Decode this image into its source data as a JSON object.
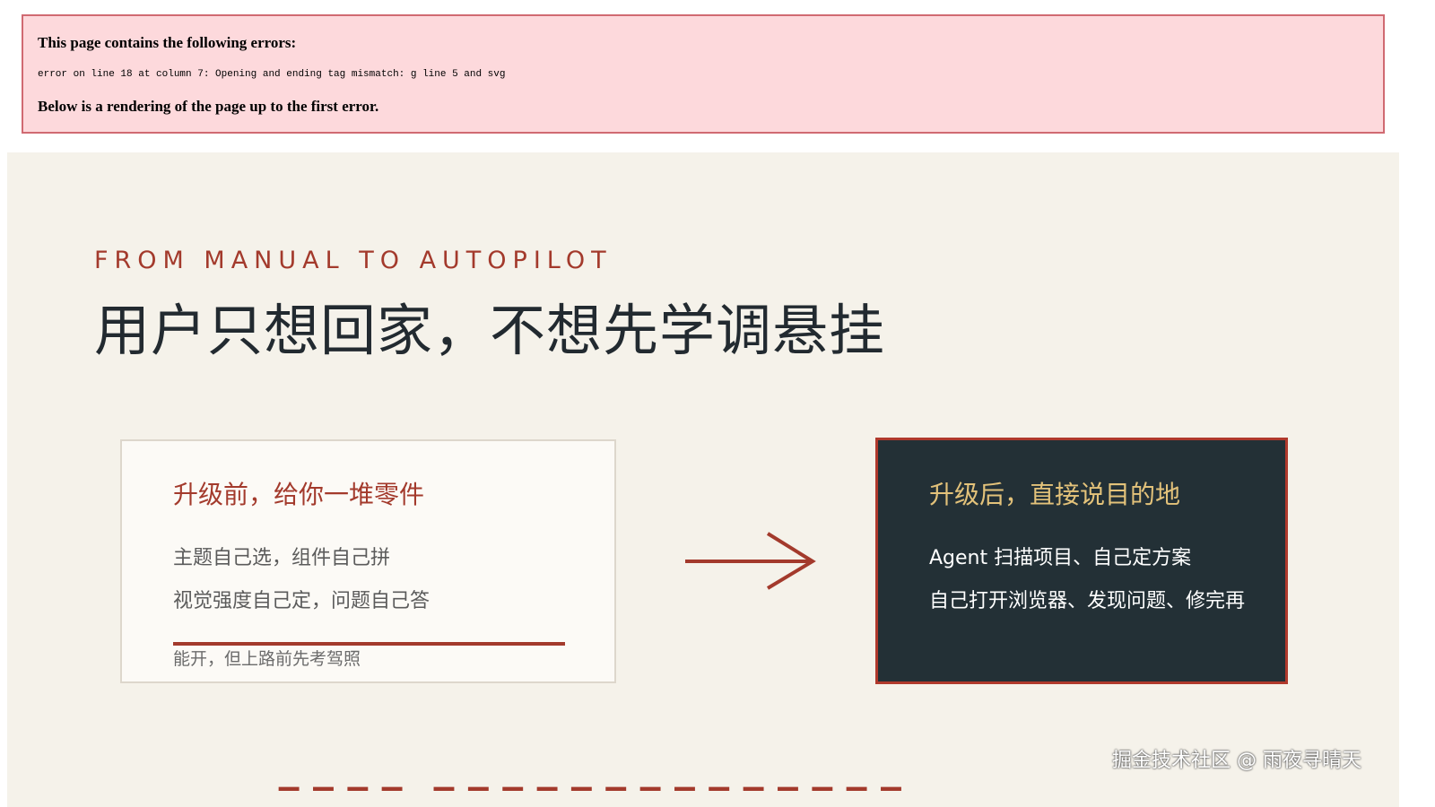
{
  "error": {
    "title": "This page contains the following errors:",
    "message": "error on line 18 at column 7: Opening and ending tag mismatch: g line 5 and svg",
    "below": "Below is a rendering of the page up to the first error."
  },
  "slide": {
    "eyebrow": "FROM MANUAL TO AUTOPILOT",
    "headline": "用户只想回家，不想先学调悬挂",
    "before": {
      "title": "升级前，给你一堆零件",
      "line1": "主题自己选，组件自己拼",
      "line2": "视觉强度自己定，问题自己答",
      "note": "能开，但上路前先考驾照"
    },
    "after": {
      "title": "升级后，直接说目的地",
      "line1": "Agent 扫描项目、自己定方案",
      "line2": "自己打开浏览器、发现问题、修完再"
    },
    "watermark": "掘金技术社区 @ 雨夜寻晴天"
  },
  "colors": {
    "accent_red": "#a33a2c",
    "gold": "#e3c27a",
    "dark_card": "#233036",
    "slide_bg": "#f5f2ea",
    "error_bg": "#fdd9dc"
  }
}
